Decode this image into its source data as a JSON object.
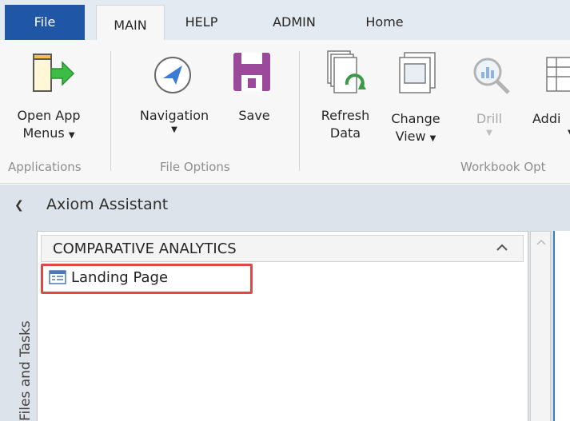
{
  "tabs": {
    "file": "File",
    "main": "MAIN",
    "help": "HELP",
    "admin": "ADMIN",
    "home": "Home"
  },
  "ribbon": {
    "open_app_menus": {
      "line1": "Open App",
      "line2": "Menus"
    },
    "navigation": {
      "label": "Navigation"
    },
    "save": {
      "label": "Save"
    },
    "refresh_data": {
      "line1": "Refresh",
      "line2": "Data"
    },
    "change_view": {
      "line1": "Change",
      "line2": "View"
    },
    "drill": {
      "label": "Drill"
    },
    "add": {
      "label": "Addi"
    },
    "groups": {
      "applications": "Applications",
      "file_options": "File Options",
      "workbook_options": "Workbook Opt"
    }
  },
  "assistant": {
    "title": "Axiom Assistant",
    "side_tab": "Files and Tasks",
    "section_title": "COMPARATIVE ANALYTICS",
    "items": [
      {
        "label": "Landing Page"
      }
    ]
  },
  "colors": {
    "file_tab": "#1f57a6",
    "highlight": "#e04848",
    "save_icon": "#9b4a9b",
    "refresh_icon": "#3a9a46",
    "arrow_icon": "#3dbd45",
    "nav_icon": "#3a7bd5"
  },
  "icons": {
    "open_app": "open-app-menus-icon",
    "navigation": "navigation-compass-icon",
    "save": "save-disk-icon",
    "refresh": "refresh-data-icon",
    "change_view": "change-view-icon",
    "drill": "drill-magnifier-icon",
    "add": "add-sheet-icon",
    "landing": "landing-page-icon"
  }
}
